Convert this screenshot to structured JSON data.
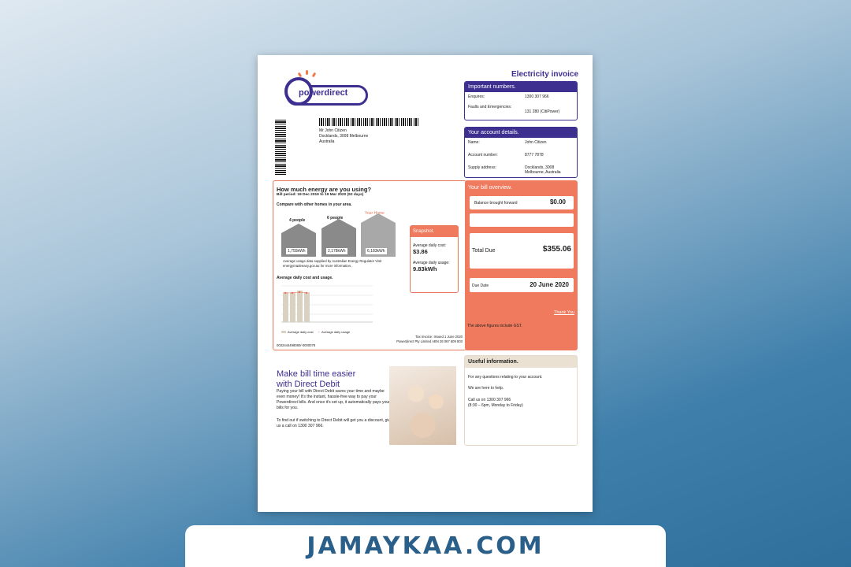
{
  "invoice": {
    "title": "Electricity invoice",
    "logo_text": "powerdirect",
    "address": [
      "Mr John Citizen",
      "Docklands, 3008 Melbourne",
      "Australia"
    ]
  },
  "important_numbers": {
    "header": "Important numbers.",
    "rows": [
      {
        "label": "Enquires:",
        "value": "1300 307 966"
      },
      {
        "label": "Faults and Emergencies:",
        "value": "131 280 (CitiPower)"
      }
    ]
  },
  "account_details": {
    "header": "Your account details.",
    "rows": [
      {
        "label": "Name:",
        "value": "John Citizen"
      },
      {
        "label": "Account number:",
        "value": "8777 7878"
      },
      {
        "label": "Supply address:",
        "value": "Docklands, 3008 Melbourne, Australia"
      }
    ]
  },
  "energy": {
    "title": "How much energy are you using?",
    "bill_period": "Bill period: 19 Dec 2019 to 19 Mar 2020 (92 days)",
    "compare_title": "Compare with other homes in your area.",
    "homes": [
      {
        "label": "4 people",
        "value": "1,755kWh"
      },
      {
        "label": "6 people",
        "value": "2,178kWh"
      },
      {
        "label": "Your Home",
        "value": "6,183kWh"
      }
    ],
    "note": "Average usage data supplied by Australian Energy Regulator Visit energymadeeasy.gov.au for more information.",
    "daily_title": "Average daily cost and usage.",
    "legend_cost": "Average daily cost",
    "legend_usage": "Average daily usage",
    "tax_invoice": "Tax Invoice: Issued 1 June 2020",
    "abn": "Powerdirect Pty Limited ABN 28 067 609 803",
    "ref": "0032444498080/-0000078"
  },
  "snapshot": {
    "header": "Snapshot.",
    "cost_label": "Average daily cost:",
    "cost_value": "$3.86",
    "usage_label": "Average daily usage:",
    "usage_value": "9.83kWh"
  },
  "overview": {
    "header": "Your bill overview.",
    "balance_label": "Balance brought forward",
    "balance_value": "$0.00",
    "total_label": "Total Due",
    "total_value": "$355.06",
    "due_label": "Due Date",
    "due_value": "20 June 2020",
    "thanks": "Thank You",
    "gst": "The above figures include GST."
  },
  "direct_debit": {
    "title1": "Make bill time easier",
    "title2": "with Direct Debit",
    "body1": "Paying your bill with Direct Debit saves your time and maybe even money! It's the instant, hassle-free way to pay your Powerdirect bills. And once it's set up, it automatically pays your bills for you.",
    "body2": "To find out if switching to Direct Debit will get you a discount, give us a call on 1300 307 966."
  },
  "useful": {
    "header": "Useful information.",
    "line1": "For any questions relating to your account.",
    "line2": "We are here to help.",
    "line3": "Call us on 1300 307 966",
    "line4": "(8:30 – 6pm, Monday to Friday)"
  },
  "watermark": "JAMAYKAA.COM"
}
